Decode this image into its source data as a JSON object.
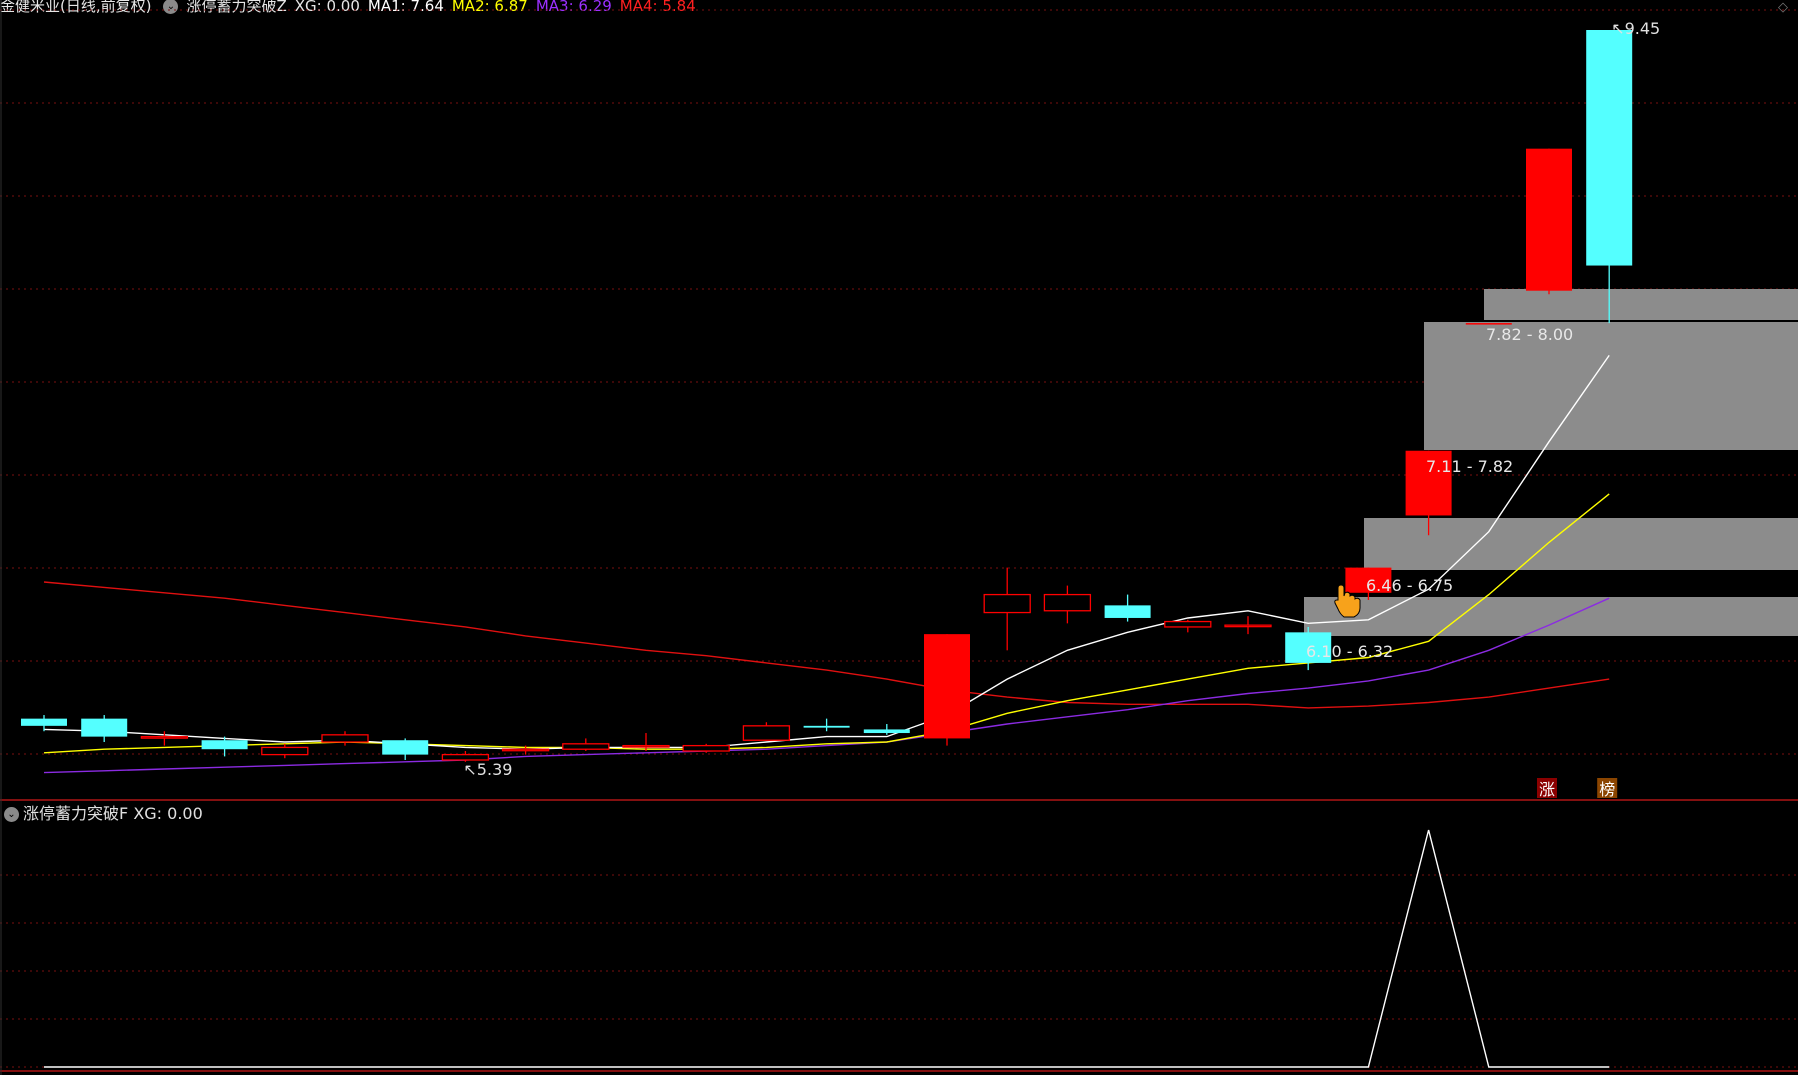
{
  "header": {
    "stock_name": "金健米业(日线,前复权)",
    "indicator": "涨停蓄力突破Z",
    "xg": "XG: 0.00",
    "ma1": "MA1: 7.64",
    "ma2": "MA2: 6.87",
    "ma3": "MA3: 6.29",
    "ma4": "MA4: 5.84"
  },
  "sub_panel": {
    "indicator": "涨停蓄力突破F",
    "xg": "XG: 0.00"
  },
  "price_labels": {
    "high": "9.45",
    "low": "5.39"
  },
  "zones": [
    {
      "label": "7.82 - 8.00"
    },
    {
      "label": "7.11 - 7.82"
    },
    {
      "label": "6.46 - 6.75"
    },
    {
      "label": "6.10 - 6.32"
    }
  ],
  "markers": {
    "zhang": "涨",
    "bang": "榜"
  },
  "colors": {
    "up": "#ff0000",
    "down": "#54ffff",
    "ma1": "#ffffff",
    "ma2": "#ffff00",
    "ma3": "#8b2be2",
    "ma4": "#e01010",
    "zone": "#8c8c8c",
    "grid": "#7a1010"
  },
  "chart_data": {
    "type": "candlestick",
    "price_axis_range": [
      5.2,
      9.6
    ],
    "candles": [
      {
        "open": 5.62,
        "close": 5.58,
        "high": 5.64,
        "low": 5.55
      },
      {
        "open": 5.62,
        "close": 5.52,
        "high": 5.64,
        "low": 5.49
      },
      {
        "open": 5.52,
        "close": 5.52,
        "high": 5.55,
        "low": 5.47
      },
      {
        "open": 5.5,
        "close": 5.45,
        "high": 5.52,
        "low": 5.41
      },
      {
        "open": 5.42,
        "close": 5.46,
        "high": 5.48,
        "low": 5.4
      },
      {
        "open": 5.49,
        "close": 5.53,
        "high": 5.55,
        "low": 5.47
      },
      {
        "open": 5.5,
        "close": 5.42,
        "high": 5.51,
        "low": 5.39
      },
      {
        "open": 5.39,
        "close": 5.42,
        "high": 5.44,
        "low": 5.38
      },
      {
        "open": 5.45,
        "close": 5.45,
        "high": 5.47,
        "low": 5.42
      },
      {
        "open": 5.45,
        "close": 5.48,
        "high": 5.51,
        "low": 5.44
      },
      {
        "open": 5.47,
        "close": 5.47,
        "high": 5.54,
        "low": 5.44
      },
      {
        "open": 5.44,
        "close": 5.47,
        "high": 5.48,
        "low": 5.43
      },
      {
        "open": 5.5,
        "close": 5.58,
        "high": 5.6,
        "low": 5.5
      },
      {
        "open": 5.58,
        "close": 5.57,
        "high": 5.62,
        "low": 5.55
      },
      {
        "open": 5.56,
        "close": 5.54,
        "high": 5.59,
        "low": 5.53
      },
      {
        "open": 5.51,
        "close": 6.09,
        "high": 6.09,
        "low": 5.47
      },
      {
        "open": 6.21,
        "close": 6.31,
        "high": 6.46,
        "low": 6.0
      },
      {
        "open": 6.22,
        "close": 6.31,
        "high": 6.36,
        "low": 6.15
      },
      {
        "open": 6.25,
        "close": 6.18,
        "high": 6.31,
        "low": 6.16
      },
      {
        "open": 6.13,
        "close": 6.16,
        "high": 6.17,
        "low": 6.1
      },
      {
        "open": 6.14,
        "close": 6.14,
        "high": 6.19,
        "low": 6.09
      },
      {
        "open": 6.1,
        "close": 5.93,
        "high": 6.13,
        "low": 5.89
      },
      {
        "open": 6.32,
        "close": 6.46,
        "high": 6.46,
        "low": 6.28
      },
      {
        "open": 6.75,
        "close": 7.11,
        "high": 7.11,
        "low": 6.64
      },
      {
        "open": 7.82,
        "close": 7.82,
        "high": 7.82,
        "low": 7.82
      },
      {
        "open": 8.0,
        "close": 8.79,
        "high": 8.79,
        "low": 7.98
      },
      {
        "open": 9.45,
        "close": 8.14,
        "high": 9.45,
        "low": 7.82
      }
    ],
    "ma1": [
      5.56,
      5.55,
      5.53,
      5.51,
      5.49,
      5.5,
      5.48,
      5.46,
      5.45,
      5.46,
      5.46,
      5.46,
      5.49,
      5.52,
      5.52,
      5.64,
      5.84,
      6.0,
      6.1,
      6.18,
      6.22,
      6.15,
      6.17,
      6.34,
      6.66,
      7.16,
      7.64
    ],
    "ma2": [
      5.43,
      5.45,
      5.46,
      5.47,
      5.48,
      5.49,
      5.48,
      5.47,
      5.46,
      5.46,
      5.45,
      5.45,
      5.46,
      5.48,
      5.49,
      5.55,
      5.65,
      5.72,
      5.78,
      5.84,
      5.9,
      5.93,
      5.96,
      6.05,
      6.31,
      6.6,
      6.87
    ],
    "ma3": [
      5.32,
      5.33,
      5.34,
      5.35,
      5.36,
      5.37,
      5.38,
      5.39,
      5.41,
      5.42,
      5.43,
      5.44,
      5.45,
      5.47,
      5.49,
      5.54,
      5.59,
      5.63,
      5.67,
      5.72,
      5.76,
      5.79,
      5.83,
      5.89,
      6.0,
      6.14,
      6.29
    ],
    "ma4": [
      6.38,
      6.35,
      6.32,
      6.29,
      6.25,
      6.21,
      6.17,
      6.13,
      6.08,
      6.04,
      6.0,
      5.97,
      5.93,
      5.89,
      5.84,
      5.78,
      5.74,
      5.71,
      5.7,
      5.7,
      5.7,
      5.68,
      5.69,
      5.71,
      5.74,
      5.79,
      5.84
    ],
    "sub_xg": [
      0,
      0,
      0,
      0,
      0,
      0,
      0,
      0,
      0,
      0,
      0,
      0,
      0,
      0,
      0,
      0,
      0,
      0,
      0,
      0,
      0,
      0,
      0,
      1,
      0,
      0,
      0
    ]
  }
}
